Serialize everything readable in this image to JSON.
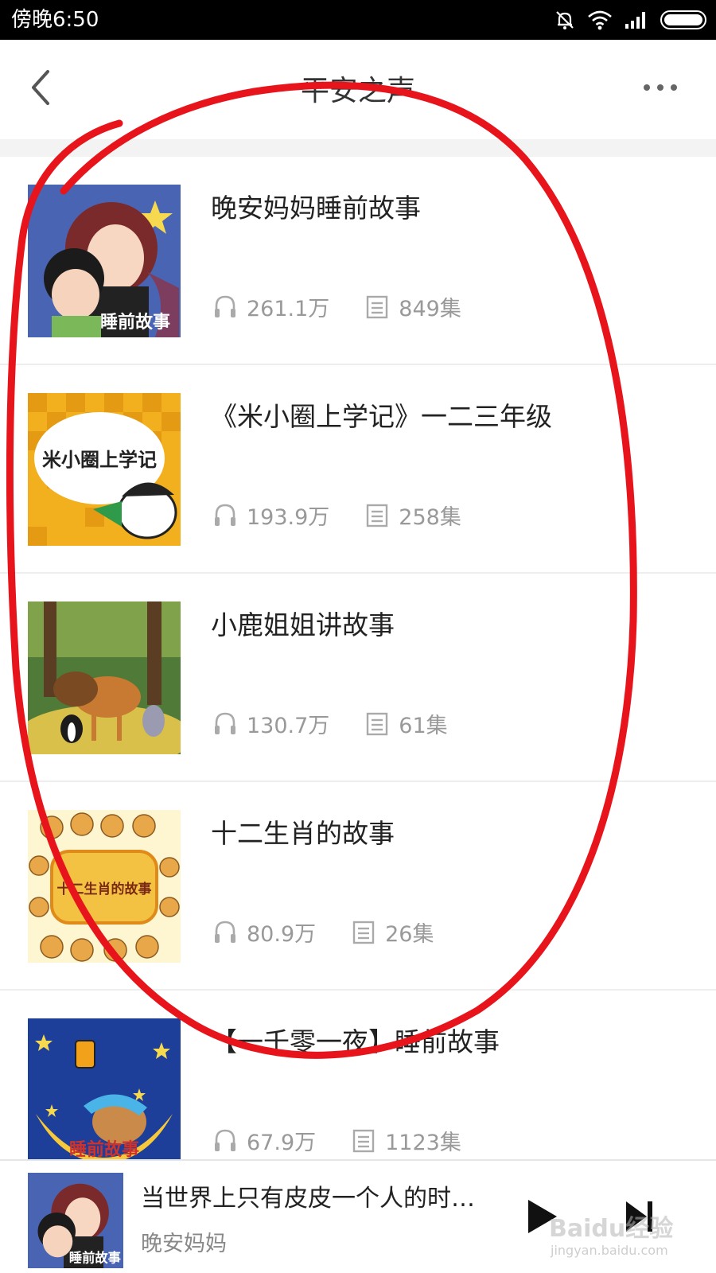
{
  "status_bar": {
    "time": "傍晚6:50",
    "icons": [
      "bell-off-icon",
      "wifi-icon",
      "signal-icon",
      "battery-icon"
    ]
  },
  "header": {
    "title": "平安之声",
    "back_icon": "chevron-left-icon",
    "more_icon": "more-icon"
  },
  "items": [
    {
      "title": "晚安妈妈睡前故事",
      "plays": "261.1万",
      "episodes": "849集",
      "cover_text": "睡前故事"
    },
    {
      "title": "《米小圈上学记》一二三年级",
      "plays": "193.9万",
      "episodes": "258集",
      "cover_text": "米小圈上学记"
    },
    {
      "title": "小鹿姐姐讲故事",
      "plays": "130.7万",
      "episodes": "61集"
    },
    {
      "title": "十二生肖的故事",
      "plays": "80.9万",
      "episodes": "26集",
      "cover_text": "十二生肖的故事"
    },
    {
      "title": "【一千零一夜】睡前故事",
      "plays": "67.9万",
      "episodes": "1123集",
      "cover_text": "睡前故事"
    }
  ],
  "player": {
    "title": "当世界上只有皮皮一个人的时…",
    "author": "晚安妈妈",
    "cover_text": "睡前故事",
    "play_icon": "play-icon",
    "next_icon": "skip-next-icon"
  },
  "watermark": {
    "main": "Baidu经验",
    "sub": "jingyan.baidu.com"
  },
  "colors": {
    "annotation": "#e8141b",
    "status_bar": "#000000",
    "meta_text": "#999999"
  }
}
